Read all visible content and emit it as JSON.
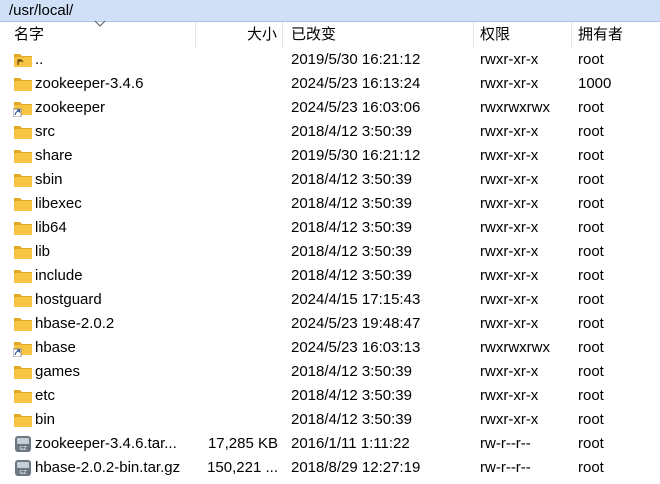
{
  "path": "/usr/local/",
  "columns": {
    "name": "名字",
    "size": "大小",
    "modified": "已改变",
    "permissions": "权限",
    "owner": "拥有者"
  },
  "colors": {
    "path_bar": "#cfe0f7",
    "folder": "#f6c342",
    "folder_dark": "#e0a824"
  },
  "files": [
    {
      "name": "..",
      "size": "",
      "modified": "2019/5/30 16:21:12",
      "permissions": "rwxr-xr-x",
      "owner": "root",
      "icon": "parent-dir-icon"
    },
    {
      "name": "zookeeper-3.4.6",
      "size": "",
      "modified": "2024/5/23 16:13:24",
      "permissions": "rwxr-xr-x",
      "owner": "1000",
      "icon": "folder-icon"
    },
    {
      "name": "zookeeper",
      "size": "",
      "modified": "2024/5/23 16:03:06",
      "permissions": "rwxrwxrwx",
      "owner": "root",
      "icon": "folder-link-icon"
    },
    {
      "name": "src",
      "size": "",
      "modified": "2018/4/12 3:50:39",
      "permissions": "rwxr-xr-x",
      "owner": "root",
      "icon": "folder-icon"
    },
    {
      "name": "share",
      "size": "",
      "modified": "2019/5/30 16:21:12",
      "permissions": "rwxr-xr-x",
      "owner": "root",
      "icon": "folder-icon"
    },
    {
      "name": "sbin",
      "size": "",
      "modified": "2018/4/12 3:50:39",
      "permissions": "rwxr-xr-x",
      "owner": "root",
      "icon": "folder-icon"
    },
    {
      "name": "libexec",
      "size": "",
      "modified": "2018/4/12 3:50:39",
      "permissions": "rwxr-xr-x",
      "owner": "root",
      "icon": "folder-icon"
    },
    {
      "name": "lib64",
      "size": "",
      "modified": "2018/4/12 3:50:39",
      "permissions": "rwxr-xr-x",
      "owner": "root",
      "icon": "folder-icon"
    },
    {
      "name": "lib",
      "size": "",
      "modified": "2018/4/12 3:50:39",
      "permissions": "rwxr-xr-x",
      "owner": "root",
      "icon": "folder-icon"
    },
    {
      "name": "include",
      "size": "",
      "modified": "2018/4/12 3:50:39",
      "permissions": "rwxr-xr-x",
      "owner": "root",
      "icon": "folder-icon"
    },
    {
      "name": "hostguard",
      "size": "",
      "modified": "2024/4/15 17:15:43",
      "permissions": "rwxr-xr-x",
      "owner": "root",
      "icon": "folder-icon"
    },
    {
      "name": "hbase-2.0.2",
      "size": "",
      "modified": "2024/5/23 19:48:47",
      "permissions": "rwxr-xr-x",
      "owner": "root",
      "icon": "folder-icon"
    },
    {
      "name": "hbase",
      "size": "",
      "modified": "2024/5/23 16:03:13",
      "permissions": "rwxrwxrwx",
      "owner": "root",
      "icon": "folder-link-icon"
    },
    {
      "name": "games",
      "size": "",
      "modified": "2018/4/12 3:50:39",
      "permissions": "rwxr-xr-x",
      "owner": "root",
      "icon": "folder-icon"
    },
    {
      "name": "etc",
      "size": "",
      "modified": "2018/4/12 3:50:39",
      "permissions": "rwxr-xr-x",
      "owner": "root",
      "icon": "folder-icon"
    },
    {
      "name": "bin",
      "size": "",
      "modified": "2018/4/12 3:50:39",
      "permissions": "rwxr-xr-x",
      "owner": "root",
      "icon": "folder-icon"
    },
    {
      "name": "zookeeper-3.4.6.tar...",
      "size": "17,285 KB",
      "modified": "2016/1/11 1:11:22",
      "permissions": "rw-r--r--",
      "owner": "root",
      "icon": "archive-icon"
    },
    {
      "name": "hbase-2.0.2-bin.tar.gz",
      "size": "150,221 ...",
      "modified": "2018/8/29 12:27:19",
      "permissions": "rw-r--r--",
      "owner": "root",
      "icon": "archive-icon"
    }
  ]
}
